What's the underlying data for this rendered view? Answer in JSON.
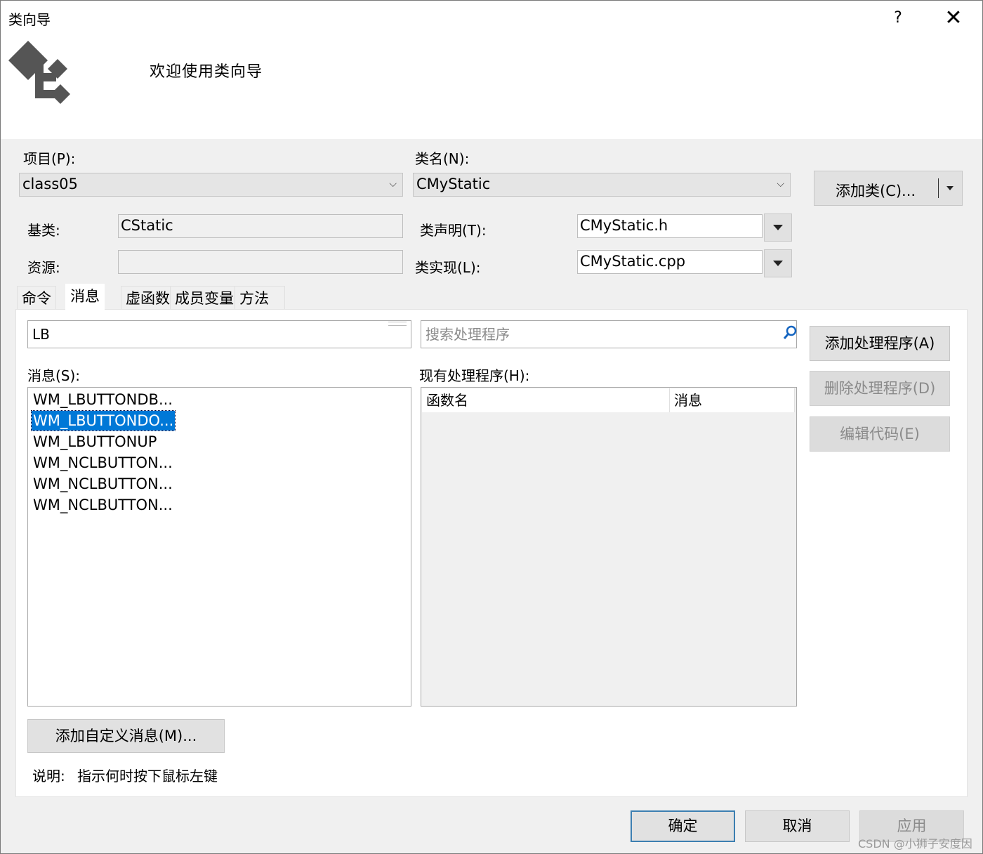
{
  "window": {
    "title": "类向导",
    "help_label": "?",
    "close_label": "✕",
    "welcome_text": "欢迎使用类向导",
    "logo_icon": "class-wizard-logo-icon"
  },
  "form": {
    "project_label": "项目(P):",
    "project_value": "class05",
    "classname_label": "类名(N):",
    "classname_value": "CMyStatic",
    "add_class_label": "添加类(C)...",
    "base_label": "基类:",
    "base_value": "CStatic",
    "resource_label": "资源:",
    "resource_value": "",
    "decl_label": "类声明(T):",
    "decl_value": "CMyStatic.h",
    "impl_label": "类实现(L):",
    "impl_value": "CMyStatic.cpp"
  },
  "tabs": [
    {
      "label": "命令"
    },
    {
      "label": "消息",
      "active": true
    },
    {
      "label": "虚函数"
    },
    {
      "label": "成员变量"
    },
    {
      "label": "方法"
    }
  ],
  "messages": {
    "filter_value": "LB",
    "handler_search_placeholder": "搜索处理程序",
    "list_label": "消息(S):",
    "items": [
      "WM_LBUTTONDB...",
      "WM_LBUTTONDO...",
      "WM_LBUTTONUP",
      "WM_NCLBUTTON...",
      "WM_NCLBUTTON...",
      "WM_NCLBUTTON..."
    ],
    "selected_index": 1,
    "handlers_label": "现有处理程序(H):",
    "handlers_columns": [
      "函数名",
      "消息"
    ],
    "add_handler_label": "添加处理程序(A)",
    "delete_handler_label": "删除处理程序(D)",
    "edit_code_label": "编辑代码(E)",
    "add_custom_label": "添加自定义消息(M)...",
    "description_label": "说明:",
    "description_text": "指示何时按下鼠标左键"
  },
  "footer": {
    "ok_label": "确定",
    "cancel_label": "取消",
    "apply_label": "应用"
  },
  "watermark": "CSDN @小狮子安度因",
  "colors": {
    "selection": "#0078d7",
    "default_button_border": "#3c7fb1",
    "dialog_bg": "#f0f0f0"
  }
}
